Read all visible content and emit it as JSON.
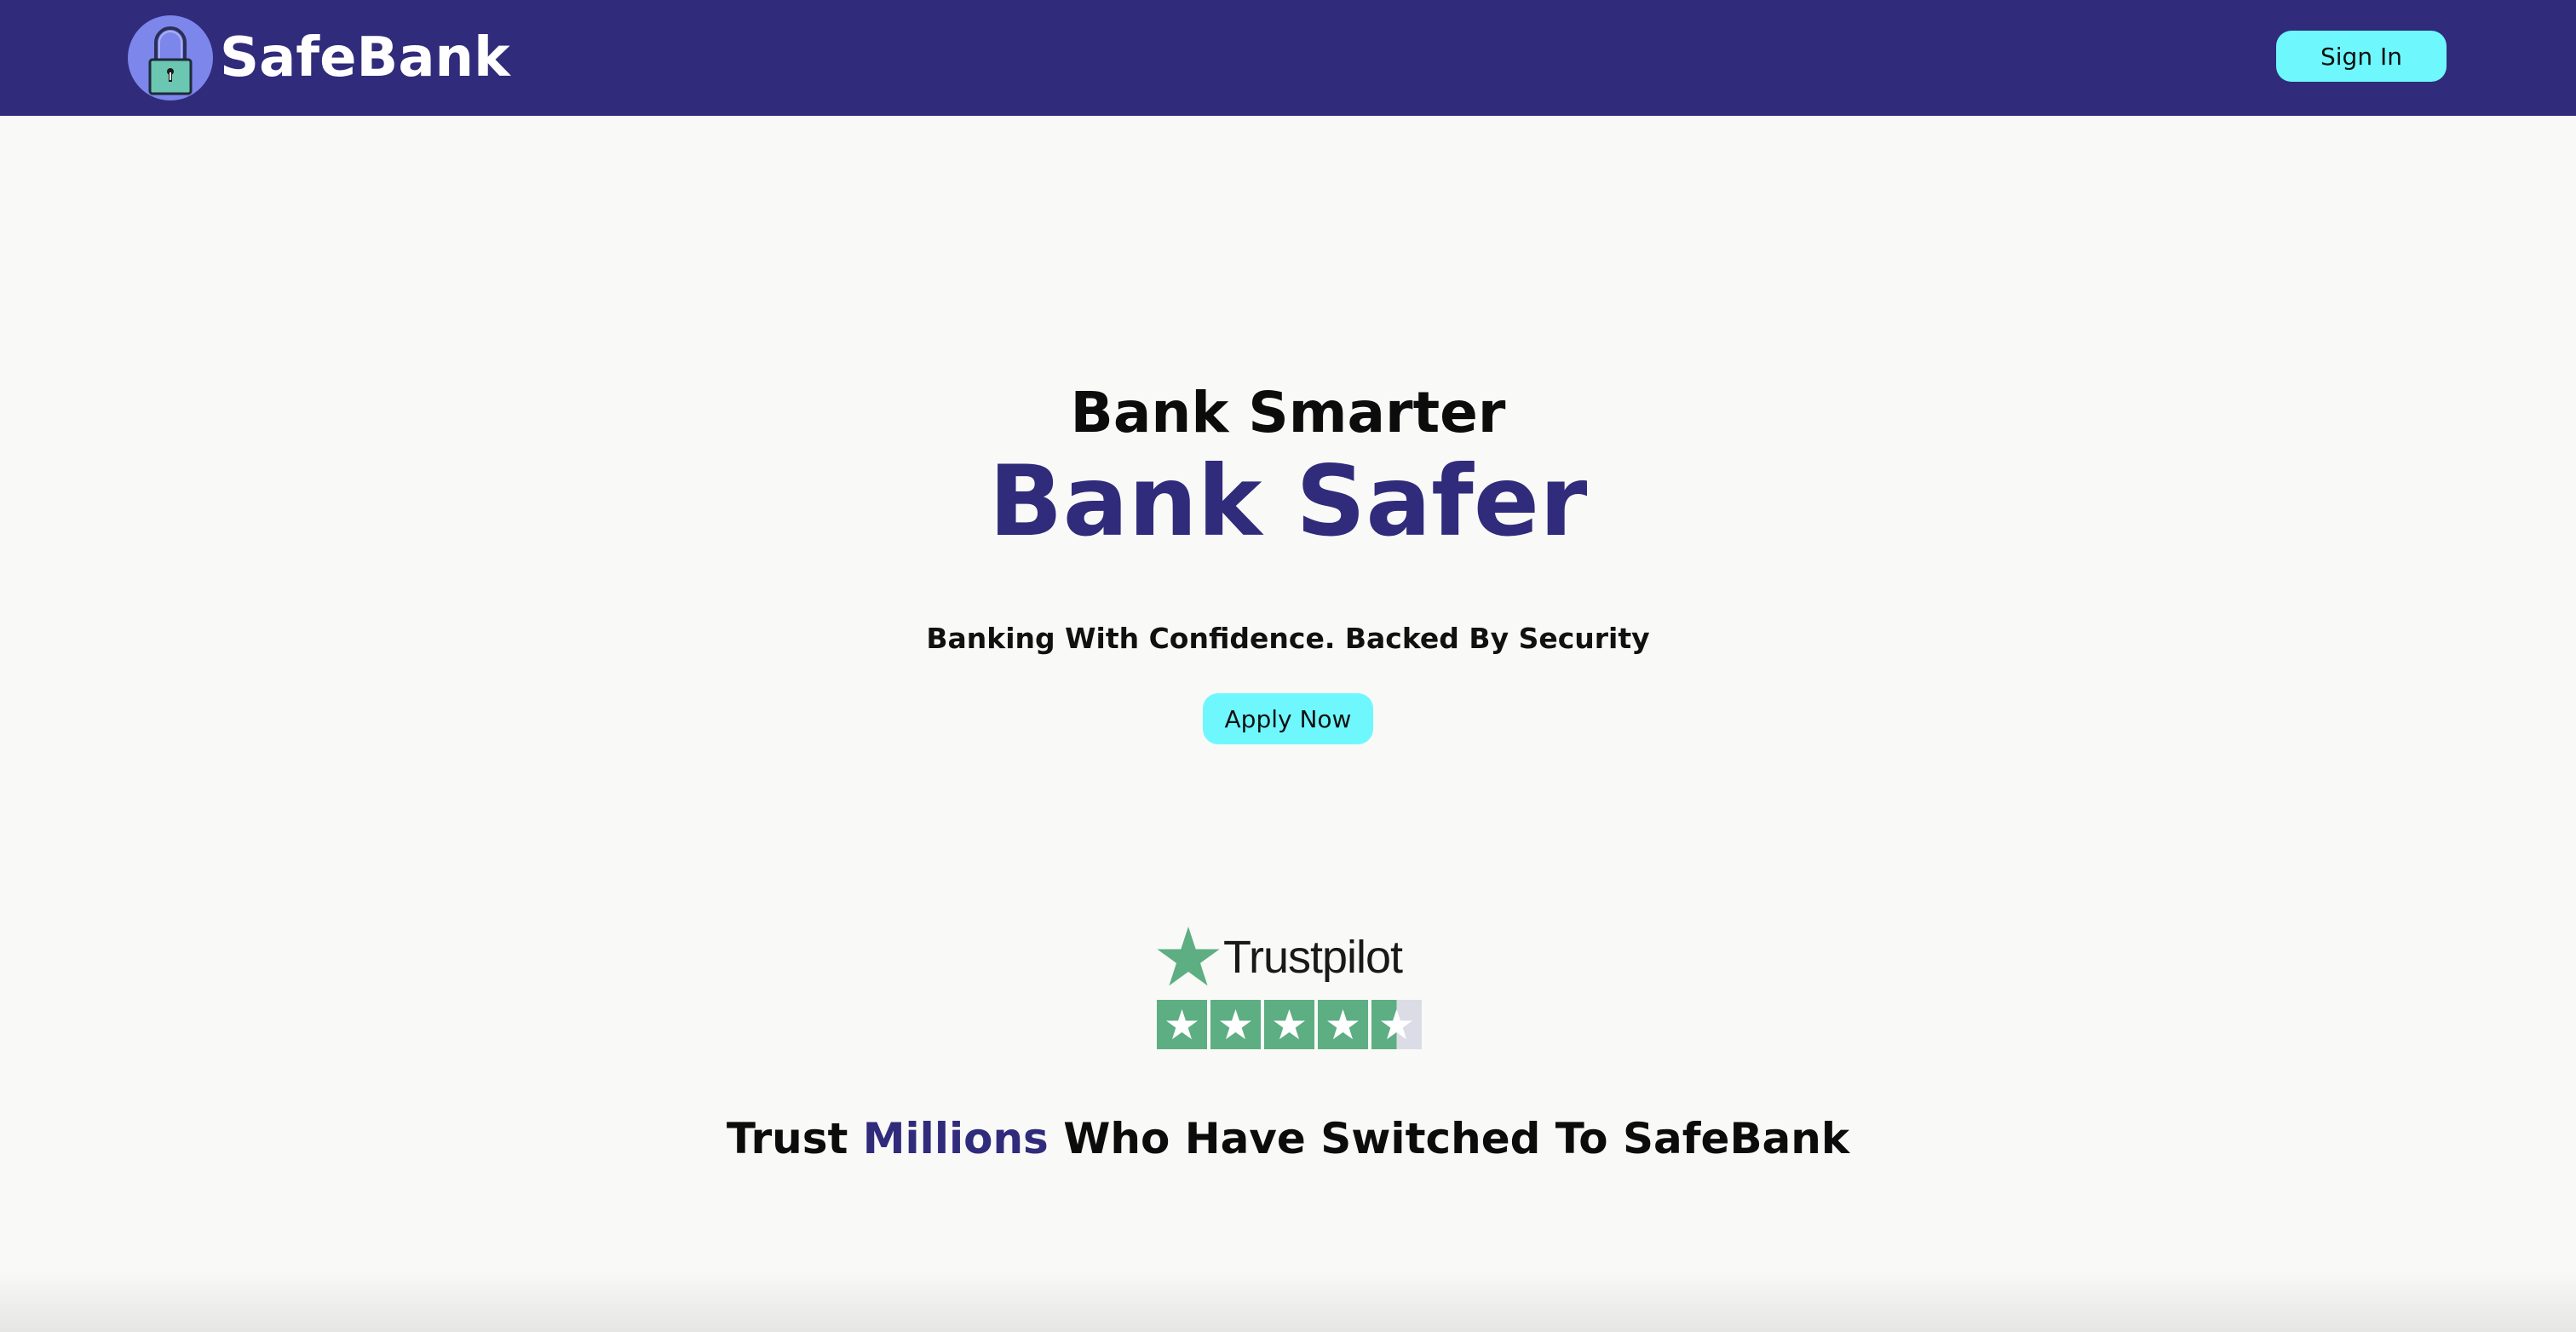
{
  "navbar": {
    "brand": "SafeBank",
    "logo_icon": "padlock-icon",
    "signin_label": "Sign In",
    "bg_color": "#302b7b",
    "button_color": "#6ef8fd"
  },
  "hero": {
    "headline_line1": "Bank Smarter",
    "headline_line2": "Bank Safer",
    "tagline": "Banking With Confidence. Backed By Security",
    "apply_label": "Apply Now",
    "accent_color": "#302b7b"
  },
  "trustpilot": {
    "name": "Trustpilot",
    "rating": 4.5,
    "max_rating": 5,
    "star_color": "#5dae82"
  },
  "trust_message": {
    "before": "Trust ",
    "highlight": "Millions",
    "after": " Who Have Switched To SafeBank"
  }
}
